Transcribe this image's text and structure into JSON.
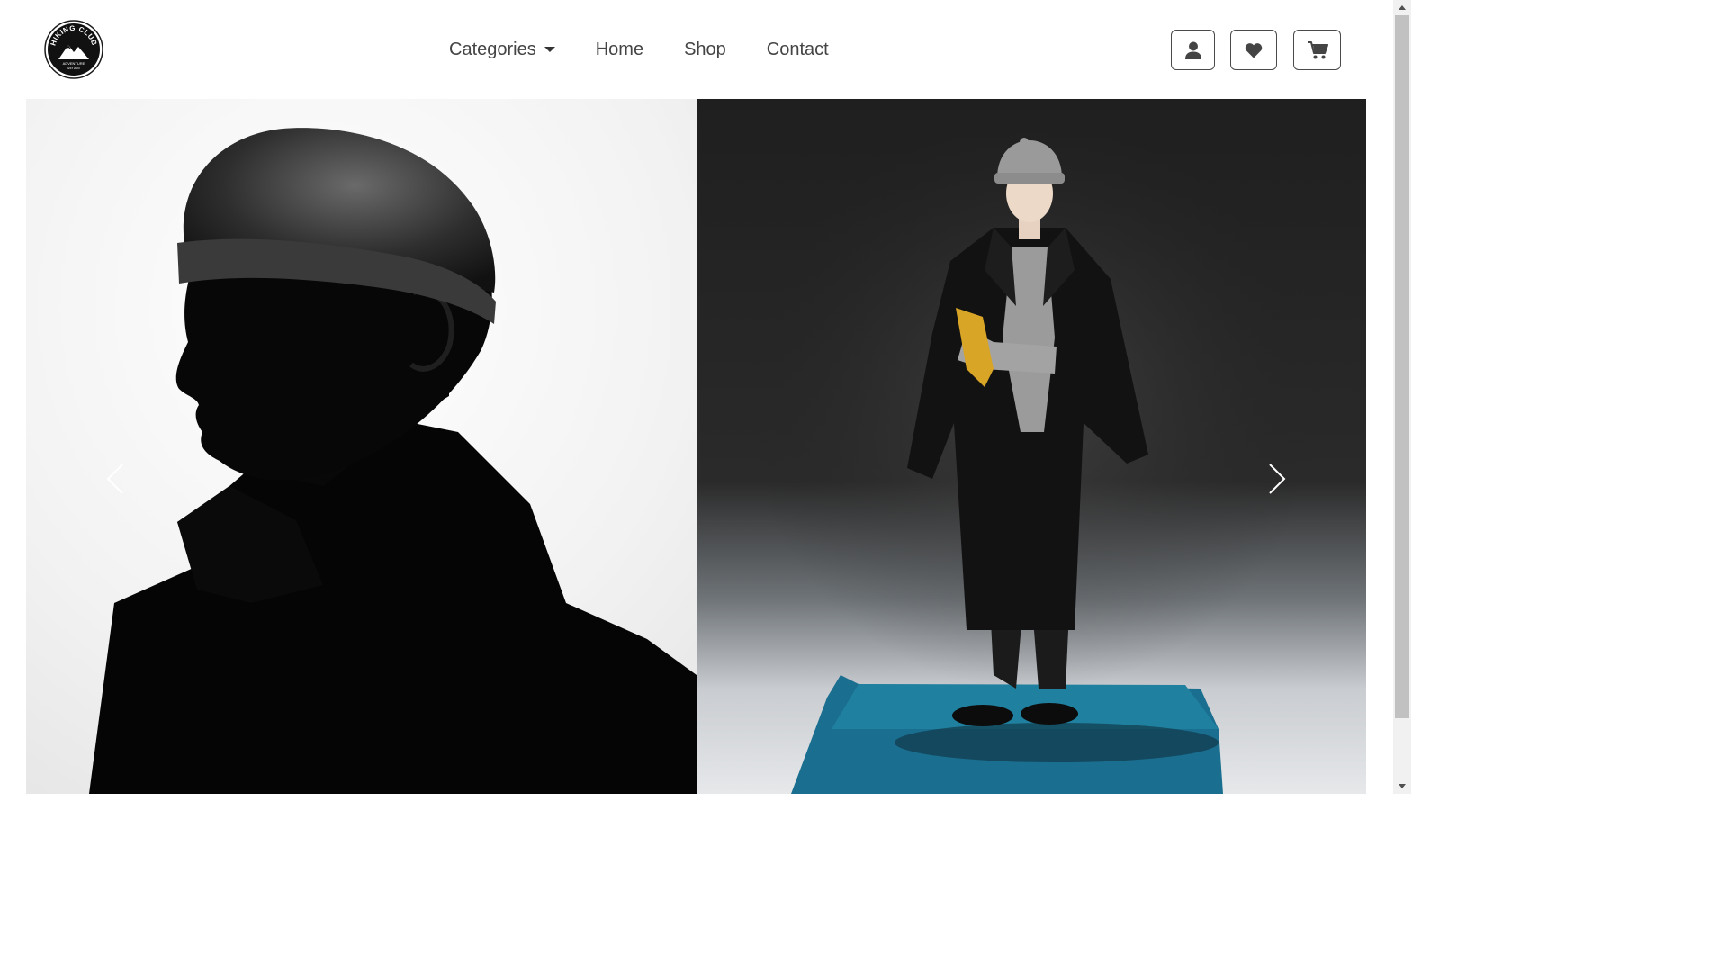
{
  "brand": {
    "logo_top_text": "HIKING CLUB",
    "logo_bottom_text": "ADVENTURE",
    "logo_est_text": "EST 2023"
  },
  "nav": {
    "items": [
      {
        "label": "Categories",
        "has_dropdown": true
      },
      {
        "label": "Home"
      },
      {
        "label": "Shop"
      },
      {
        "label": "Contact"
      }
    ]
  },
  "actions": {
    "icons": [
      "user-icon",
      "heart-icon",
      "cart-icon"
    ]
  },
  "carousel": {
    "slides": [
      {
        "image": "silhouette-portrait-beanie-coat"
      },
      {
        "image": "model-grey-beanie-black-overcoat-on-blue-platform"
      }
    ],
    "controls": {
      "prev_icon": "chevron-left-icon",
      "next_icon": "chevron-right-icon"
    }
  },
  "colors": {
    "text": "#444444",
    "button_border": "#4a4a4a",
    "platform_blue": "#1a6e8f",
    "glove_yellow": "#d9a526"
  }
}
